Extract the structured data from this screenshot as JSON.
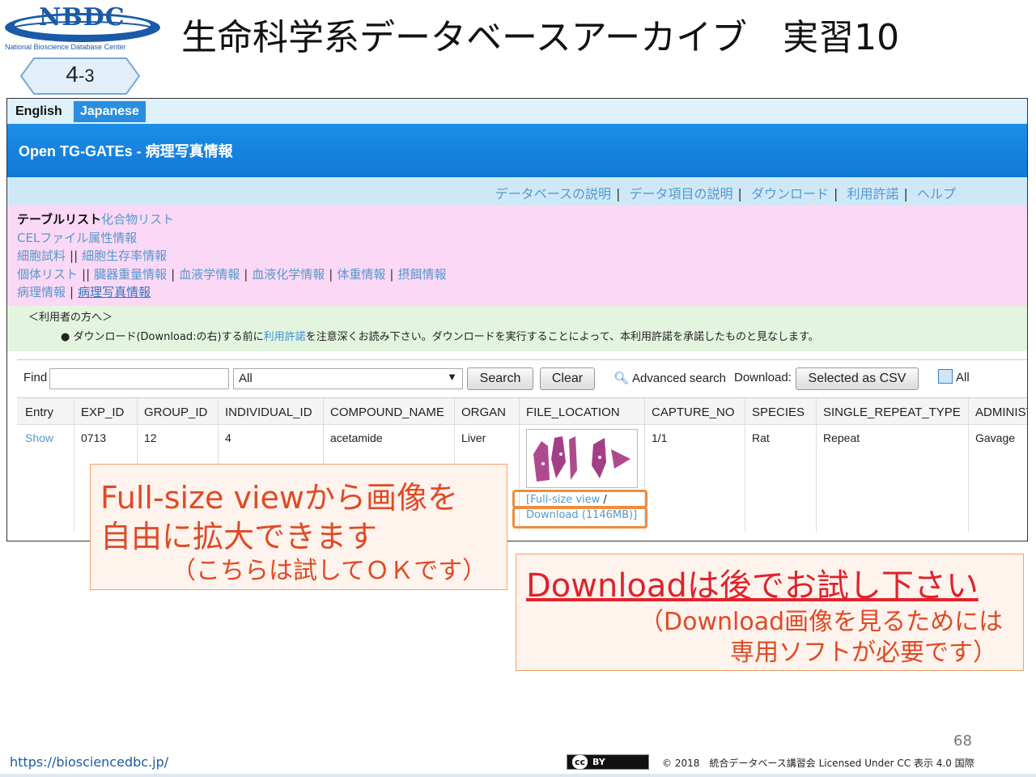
{
  "header": {
    "logo_text": "NBDC",
    "logo_subtitle": "National Bioscience Database Center",
    "title": "生命科学系データベースアーカイブ　実習10",
    "badge_main": "4",
    "badge_sub": "-3"
  },
  "app": {
    "lang_english": "English",
    "lang_japanese": "Japanese",
    "title": "Open TG-GATEs - 病理写真情報",
    "nav": {
      "db_desc": "データベースの説明",
      "field_desc": "データ項目の説明",
      "download": "ダウンロード",
      "license": "利用許諾",
      "help": "ヘルプ"
    },
    "tables": {
      "current": "テーブルリスト",
      "compound": "化合物リスト",
      "cel": "CELファイル属性情報",
      "cell_sample": "細胞試料",
      "cell_survival": "細胞生存率情報",
      "individual": "個体リスト",
      "organ_weight": "臓器重量情報",
      "hematology": "血液学情報",
      "biochem": "血液化学情報",
      "body_weight": "体重情報",
      "feeding": "摂餌情報",
      "pathology": "病理情報",
      "pathology_photo": "病理写真情報"
    },
    "notice": {
      "heading": "＜利用者の方へ＞",
      "pre": "● ダウンロード(Download:の右)する前に",
      "link": "利用許諾",
      "post": "を注意深くお読み下さい。ダウンロードを実行することによって、本利用許諾を承諾したものと見なします。"
    },
    "find": {
      "label": "Find",
      "input_value": "",
      "select_value": "All",
      "search": "Search",
      "clear": "Clear",
      "advanced": "Advanced search",
      "download_label": "Download:",
      "csv": "Selected as CSV",
      "all": "All"
    },
    "table": {
      "headers": [
        "Entry",
        "EXP_ID",
        "GROUP_ID",
        "INDIVIDUAL_ID",
        "COMPOUND_NAME",
        "ORGAN",
        "FILE_LOCATION",
        "CAPTURE_NO",
        "SPECIES",
        "SINGLE_REPEAT_TYPE",
        "ADMINISTI"
      ],
      "row": {
        "entry": "Show",
        "exp_id": "0713",
        "group_id": "12",
        "individual_id": "4",
        "compound": "acetamide",
        "organ": "Liver",
        "capture_no": "1/1",
        "species": "Rat",
        "repeat": "Repeat",
        "admin": "Gavage",
        "full_size": "[Full-size view",
        "slash": " /",
        "download": "Download (1146MB)]"
      }
    }
  },
  "callouts": {
    "left_line1": "Full-size viewから画像を",
    "left_line2": "自由に拡大できます",
    "left_line3": "（こちらは試してＯＫです）",
    "right_line1": "Downloadは後でお試し下さい",
    "right_line2": "（Download画像を見るためには",
    "right_line3": "専用ソフトが必要です）"
  },
  "footer": {
    "page_number": "68",
    "url": "https://biosciencedbc.jp/",
    "cc_icon": "cc",
    "cc_by": "BY",
    "copyright": "© 2018　統合データベース講習会 Licensed Under CC 表示 4.0 国際"
  },
  "colors": {
    "accent_blue": "#1c8ee8",
    "callout_red": "#e04a25",
    "highlight_orange": "#f08c3c"
  }
}
